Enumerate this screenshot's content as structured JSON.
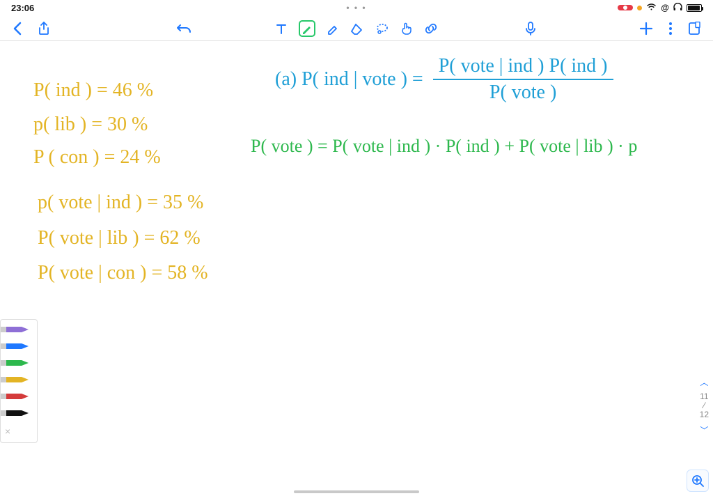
{
  "status": {
    "time": "23:06",
    "ellipsis": "• • •",
    "rec_icon": "record-indicator",
    "icons": [
      "dot",
      "wifi",
      "at",
      "headphones",
      "battery"
    ]
  },
  "toolbar": {
    "back": "back-chevron",
    "share": "share-icon",
    "undo": "undo-icon",
    "tools": [
      "text-tool",
      "pen-tool",
      "highlighter-tool",
      "eraser-tool",
      "lasso-tool",
      "hand-tool",
      "link-tool"
    ],
    "mic": "mic-icon",
    "add": "add-icon",
    "more": "more-icon",
    "page": "page-icon"
  },
  "notes": {
    "priors": {
      "p_ind": "P( ind ) = 46 %",
      "p_lib": "p( lib ) = 30 %",
      "p_con": "P ( con ) = 24 %",
      "p_vote_ind": "p( vote | ind ) = 35 %",
      "p_vote_lib": "P( vote | lib ) = 62 %",
      "p_vote_con": "P( vote | con ) = 58 %"
    },
    "bayes": {
      "label": "(a)  P( ind | vote )  =",
      "num": "P( vote | ind ) P( ind )",
      "den": "P( vote )"
    },
    "expansion": "P( vote ) =  P( vote | ind ) · P( ind )  + P( vote | lib ) · p"
  },
  "palette": {
    "colors": [
      "#8e6fd6",
      "#1f78ff",
      "#2db84d",
      "#e3b424",
      "#d43b3b",
      "#111111"
    ],
    "close": "×"
  },
  "pageNav": {
    "up": "︿",
    "current": "11",
    "sep": "⁄",
    "total": "12",
    "down": "﹀"
  },
  "zoom": "zoom-in-icon"
}
